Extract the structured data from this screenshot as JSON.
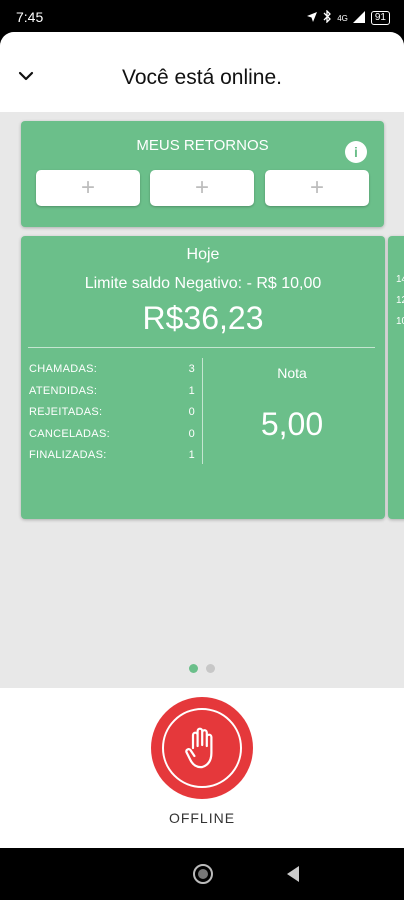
{
  "status_bar": {
    "time": "7:45",
    "signal": "4G",
    "battery": "91"
  },
  "header": {
    "title": "Você está online."
  },
  "retornos": {
    "title": "MEUS RETORNOS",
    "info_glyph": "i",
    "add_buttons": [
      "+",
      "+",
      "+"
    ]
  },
  "today_card": {
    "label": "Hoje",
    "limite": "Limite saldo Negativo: - R$ 10,00",
    "saldo": "R$36,23",
    "stats": [
      {
        "label": "CHAMADAS:",
        "value": "3"
      },
      {
        "label": "ATENDIDAS:",
        "value": "1"
      },
      {
        "label": "REJEITADAS:",
        "value": "0"
      },
      {
        "label": "CANCELADAS:",
        "value": "0"
      },
      {
        "label": "FINALIZADAS:",
        "value": "1"
      }
    ],
    "nota_label": "Nota",
    "nota_value": "5,00"
  },
  "next_card_peek": [
    "14",
    "12",
    "10"
  ],
  "pager": {
    "pages": 2,
    "active": 0
  },
  "offline": {
    "label": "OFFLINE"
  },
  "colors": {
    "accent_green": "#6bbf8a",
    "offline_red": "#e5383b"
  }
}
